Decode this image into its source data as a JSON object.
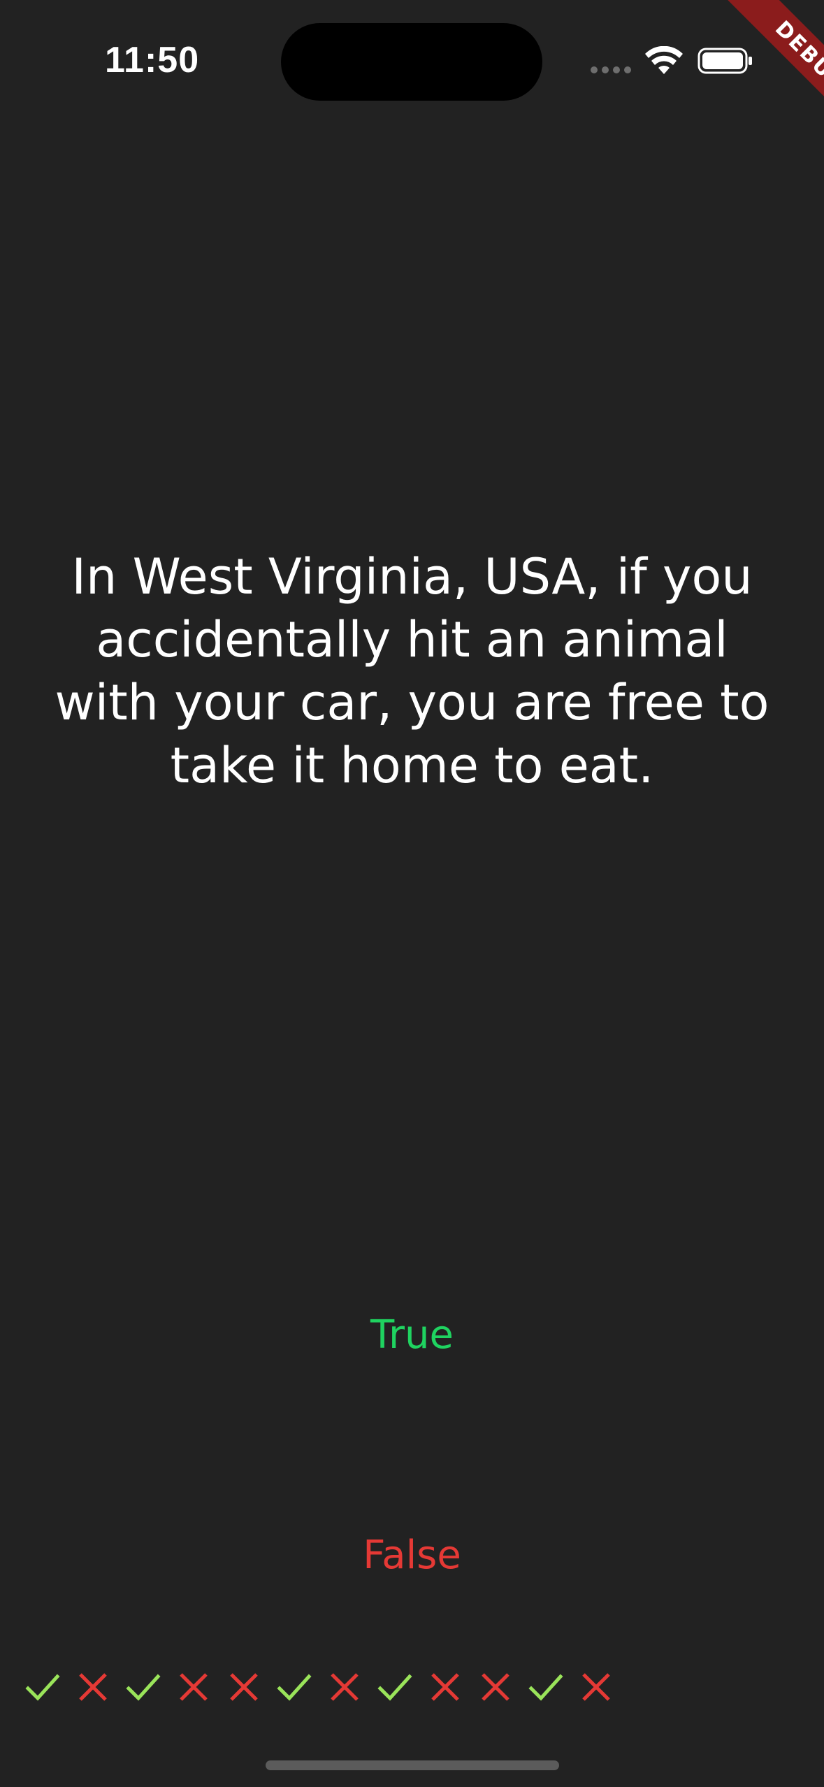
{
  "status_bar": {
    "time": "11:50"
  },
  "debug_banner": {
    "label": "DEBUG"
  },
  "question": {
    "text": "In West Virginia, USA, if you accidentally hit an animal with your car, you are free to take it home to eat."
  },
  "answers": {
    "true_label": "True",
    "false_label": "False"
  },
  "score": {
    "marks": [
      "correct",
      "wrong",
      "correct",
      "wrong",
      "wrong",
      "correct",
      "wrong",
      "correct",
      "wrong",
      "wrong",
      "correct",
      "wrong"
    ]
  },
  "colors": {
    "background": "#222222",
    "true": "#1fd360",
    "false": "#e53935",
    "check": "#9ae45a",
    "cross": "#e53935",
    "debug_ribbon": "#8b1c1c"
  },
  "icons": {
    "correct": "check-icon",
    "wrong": "close-icon"
  }
}
